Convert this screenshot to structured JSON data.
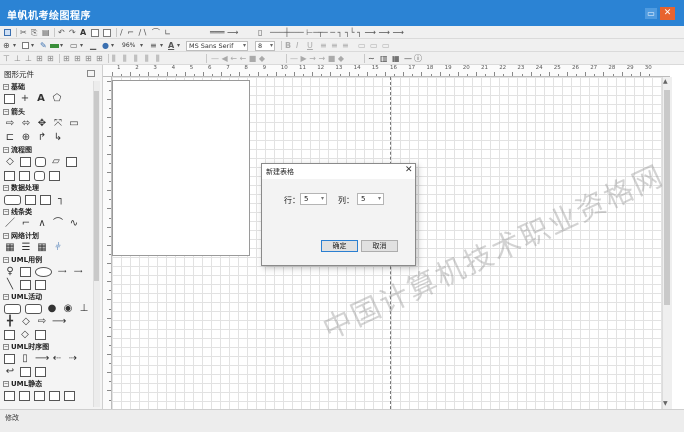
{
  "window": {
    "title": "单帆机考绘图程序",
    "minimize_glyph": "▭",
    "close_glyph": "✕"
  },
  "toolbar": {
    "zoom": "96%",
    "font_name": "MS Sans Serif",
    "font_size": "8",
    "dropdown_arrow": "▾"
  },
  "left_panel": {
    "title": "图形元件",
    "categories": [
      {
        "label": "基础"
      },
      {
        "label": "箭头"
      },
      {
        "label": "流程图"
      },
      {
        "label": "数据处理"
      },
      {
        "label": "线条类"
      },
      {
        "label": "网络计划"
      },
      {
        "label": "UML用例"
      },
      {
        "label": "UML活动"
      },
      {
        "label": "UML时序图"
      },
      {
        "label": "UML静态"
      }
    ]
  },
  "ruler": {
    "numbers": [
      "1",
      "2",
      "3",
      "4",
      "5",
      "6",
      "7",
      "8",
      "9",
      "10",
      "11",
      "12",
      "13",
      "14",
      "15",
      "16",
      "17",
      "18",
      "19",
      "20",
      "21",
      "22",
      "23",
      "24",
      "25",
      "26",
      "27",
      "28",
      "29",
      "30"
    ]
  },
  "dialog": {
    "title": "新建表格",
    "close_glyph": "✕",
    "rows_label": "行：",
    "rows_value": "5",
    "cols_label": "列：",
    "cols_value": "5",
    "ok_label": "确定",
    "cancel_label": "取消"
  },
  "status": {
    "text": "修改"
  },
  "watermark": {
    "text": "中国计算机技术职业资格网"
  },
  "colors": {
    "titlebar": "#2b83d4",
    "close_button": "#e8632f",
    "grid_line": "#e2e2e2"
  },
  "icons": [
    "save-icon",
    "cut-icon",
    "copy-icon",
    "paste-icon",
    "undo-icon",
    "redo-icon",
    "text-icon",
    "line-icon",
    "rectangle-icon",
    "ellipse-icon",
    "table-icon",
    "align-icon"
  ]
}
